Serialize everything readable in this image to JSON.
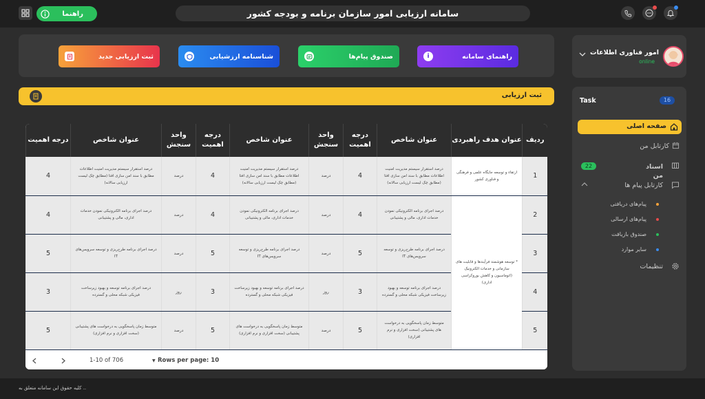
{
  "header": {
    "title": "سامانه ارزیابی امور سازمان برنامه و بودجه کشور",
    "help_label": "راهنما"
  },
  "profile": {
    "name": "امور فناوری اطلاعات",
    "status": "online"
  },
  "sidebar": {
    "task_label": "Task",
    "task_count": "16",
    "home": "صفحه اصلی",
    "my_cartable": "کارتابل من",
    "documents": "اسناد من",
    "documents_count": "22",
    "messages_cartable": "کارتابل پیام ها",
    "sub_items": [
      "پیام‌های دریافتی",
      "پیام‌های ارسالی",
      "صندوق بازیافت",
      "سایر موارد"
    ],
    "sub_colors": [
      "#f7a23a",
      "#e84c4c",
      "#2bbf5c",
      "#3a8cf0"
    ],
    "settings": "تنظیمات"
  },
  "actions": [
    {
      "label": "راهنمای سامانه",
      "gradient": [
        "#8e3df0",
        "#5a2be0"
      ]
    },
    {
      "label": "صندوق پیام‌ها",
      "gradient": [
        "#2bd06a",
        "#1fa955"
      ]
    },
    {
      "label": "شناسنامه ارزشیابی",
      "gradient": [
        "#2b8cf0",
        "#1a4fd8"
      ]
    },
    {
      "label": "ثبت ارزیابی جدید",
      "gradient": [
        "#f7a23a",
        "#e8344c"
      ]
    }
  ],
  "banner": {
    "label": "ثبت ارزیابی"
  },
  "table": {
    "headers": [
      "ردیف",
      "عنوان هدف راهبردی",
      "عنوان شاخص",
      "درجه اهمیت",
      "واحد سنجش",
      "عنوان شاخص",
      "درجه اهمیت",
      "واحد سنجش",
      "عنوان شاخص",
      "درجه اهمیت"
    ],
    "goals": [
      "ارتقاء و توسعه جایگاه علمی و فرهنگی و فناوری کشور",
      "* توسعه هوشمند فرآیندها و قابلیت های سازمانی و خدمات الکترونیک (اتوماسیون و کاهش بوروکراسی اداری)"
    ],
    "rows": [
      {
        "num": "1",
        "indicator": "درصد استقرار سیستم مدیریت امنیت اطلاعات مطابق با سند امن سازی افتا (مطابق چک لیست ارزیابی سالانه)",
        "weight": "4",
        "unit": "درصد"
      },
      {
        "num": "2",
        "indicator": "درصد اجرای برنامه الکترونیکی نمودن خدمات اداری، مالی و پشتیبانی",
        "weight": "4",
        "unit": "درصد"
      },
      {
        "num": "3",
        "indicator": "درصد اجرای برنامه طرح‌ریزی و توسعه سرویس‌های IT",
        "weight": "5",
        "unit": "درصد"
      },
      {
        "num": "4",
        "indicator": "درصد اجرای برنامه توسعه و بهبود زیرساخت فیزیکی شبکه محلی و گسترده",
        "weight": "3",
        "unit": "روز"
      },
      {
        "num": "5",
        "indicator": "متوسط زمان پاسخگویی به درخواست های پشتیبانی (سخت افزاری و نرم افزاری)",
        "weight": "5",
        "unit": "درصد"
      }
    ]
  },
  "pagination": {
    "rows_per_page_label": "Rows per page: 10",
    "range": "1-10 of 706"
  },
  "footer": {
    "copyright": "کلیه حقوق این سامانه متعلق به .."
  }
}
